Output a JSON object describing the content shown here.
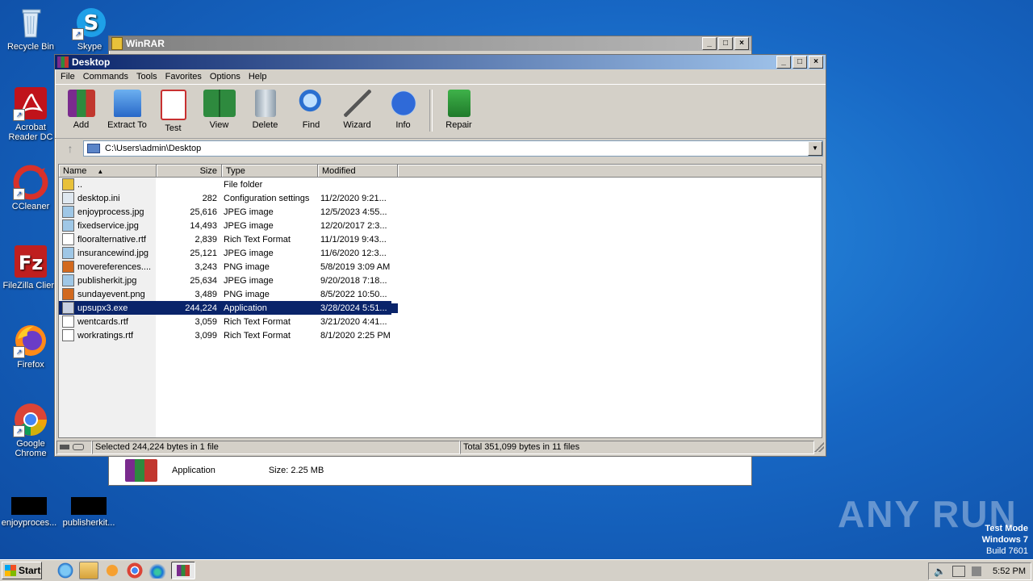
{
  "desktop": {
    "icons": [
      {
        "label": "Recycle Bin"
      },
      {
        "label": "Skype"
      },
      {
        "label": "Acrobat Reader DC"
      },
      {
        "label": "CCleaner"
      },
      {
        "label": "FileZilla Client"
      },
      {
        "label": "Firefox"
      },
      {
        "label": "Google Chrome"
      },
      {
        "label": "enjoyproces..."
      },
      {
        "label": "publisherkit..."
      }
    ],
    "watermark": "ANY RUN",
    "test_mode": [
      "Test Mode",
      "Windows 7",
      "Build 7601"
    ]
  },
  "back_window": {
    "title": "WinRAR",
    "app_type": "Application",
    "size": "Size: 2.25 MB"
  },
  "window": {
    "title": "Desktop",
    "menu": [
      "File",
      "Commands",
      "Tools",
      "Favorites",
      "Options",
      "Help"
    ],
    "toolbar": [
      "Add",
      "Extract To",
      "Test",
      "View",
      "Delete",
      "Find",
      "Wizard",
      "Info",
      "Repair"
    ],
    "address": "C:\\Users\\admin\\Desktop",
    "columns": [
      "Name",
      "Size",
      "Type",
      "Modified"
    ],
    "rows": [
      {
        "name": "..",
        "size": "",
        "type": "File folder",
        "modified": "",
        "icon": "folder-icon"
      },
      {
        "name": "desktop.ini",
        "size": "282",
        "type": "Configuration settings",
        "modified": "11/2/2020 9:21...",
        "icon": "ini-file-icon"
      },
      {
        "name": "enjoyprocess.jpg",
        "size": "25,616",
        "type": "JPEG image",
        "modified": "12/5/2023 4:55...",
        "icon": "image-file-icon"
      },
      {
        "name": "fixedservice.jpg",
        "size": "14,493",
        "type": "JPEG image",
        "modified": "12/20/2017 2:3...",
        "icon": "image-file-icon"
      },
      {
        "name": "flooralternative.rtf",
        "size": "2,839",
        "type": "Rich Text Format",
        "modified": "11/1/2019 9:43...",
        "icon": "rtf-file-icon"
      },
      {
        "name": "insurancewind.jpg",
        "size": "25,121",
        "type": "JPEG image",
        "modified": "11/6/2020 12:3...",
        "icon": "image-file-icon"
      },
      {
        "name": "movereferences....",
        "size": "3,243",
        "type": "PNG image",
        "modified": "5/8/2019 3:09 AM",
        "icon": "png-file-icon"
      },
      {
        "name": "publisherkit.jpg",
        "size": "25,634",
        "type": "JPEG image",
        "modified": "9/20/2018 7:18...",
        "icon": "image-file-icon"
      },
      {
        "name": "sundayevent.png",
        "size": "3,489",
        "type": "PNG image",
        "modified": "8/5/2022 10:50...",
        "icon": "png-file-icon"
      },
      {
        "name": "upsupx3.exe",
        "size": "244,224",
        "type": "Application",
        "modified": "3/28/2024 5:51...",
        "icon": "exe-file-icon",
        "selected": true
      },
      {
        "name": "wentcards.rtf",
        "size": "3,059",
        "type": "Rich Text Format",
        "modified": "3/21/2020 4:41...",
        "icon": "rtf-file-icon"
      },
      {
        "name": "workratings.rtf",
        "size": "3,099",
        "type": "Rich Text Format",
        "modified": "8/1/2020 2:25 PM",
        "icon": "rtf-file-icon"
      }
    ],
    "status_left": "Selected 244,224 bytes in 1 file",
    "status_right": "Total 351,099 bytes in 11 files"
  },
  "taskbar": {
    "start_label": "Start",
    "clock": "5:52 PM"
  }
}
